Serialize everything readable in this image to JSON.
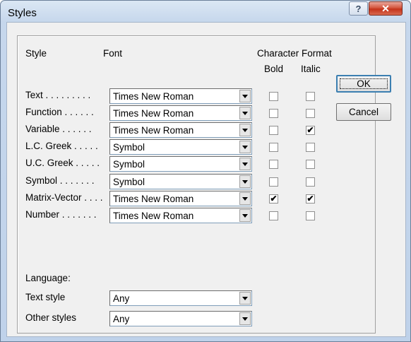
{
  "window": {
    "title": "Styles",
    "help_glyph": "?",
    "close_glyph": "✕"
  },
  "headers": {
    "style": "Style",
    "font": "Font",
    "char_format": "Character Format",
    "bold": "Bold",
    "italic": "Italic"
  },
  "rows": [
    {
      "label": "Text . . . . . . . . .",
      "font": "Times New Roman",
      "bold": false,
      "italic": false
    },
    {
      "label": "Function . . . . . .",
      "font": "Times New Roman",
      "bold": false,
      "italic": false
    },
    {
      "label": "Variable . . . . . .",
      "font": "Times New Roman",
      "bold": false,
      "italic": true
    },
    {
      "label": "L.C. Greek . . . . .",
      "font": "Symbol",
      "bold": false,
      "italic": false
    },
    {
      "label": "U.C. Greek . . . . .",
      "font": "Symbol",
      "bold": false,
      "italic": false
    },
    {
      "label": "Symbol . . . . . . .",
      "font": "Symbol",
      "bold": false,
      "italic": false
    },
    {
      "label": "Matrix-Vector . . . .",
      "font": "Times New Roman",
      "bold": true,
      "italic": true
    },
    {
      "label": "Number . . . . . . .",
      "font": "Times New Roman",
      "bold": false,
      "italic": false
    }
  ],
  "language": {
    "heading": "Language:",
    "text_style_label": "Text style",
    "text_style_value": "Any",
    "other_styles_label": "Other styles",
    "other_styles_value": "Any"
  },
  "buttons": {
    "ok": "OK",
    "cancel": "Cancel"
  },
  "check_glyph": "✔"
}
